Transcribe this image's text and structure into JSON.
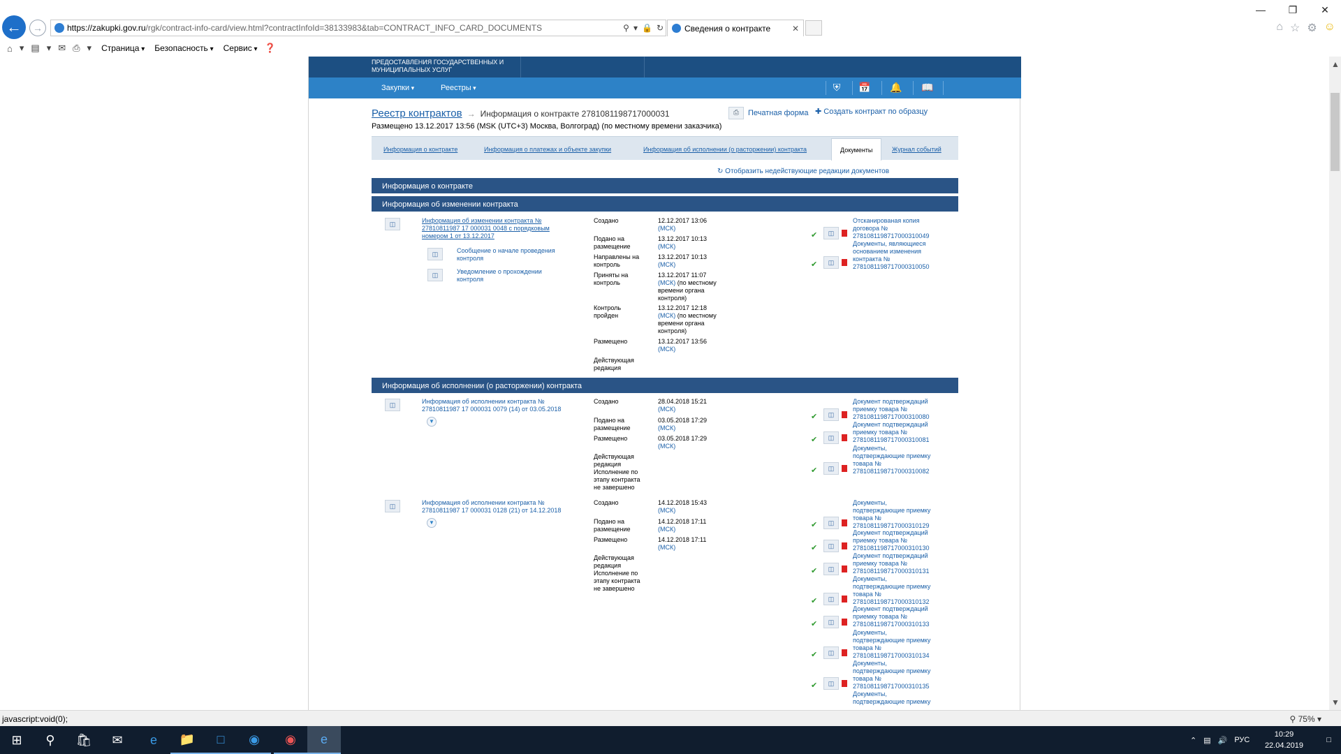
{
  "browser": {
    "url_host": "https://zakupki.gov.ru",
    "url_path": "/rgk/contract-info-card/view.html?contractInfoId=38133983&tab=CONTRACT_INFO_CARD_DOCUMENTS",
    "tab_title": "Сведения о контракте",
    "window_buttons": [
      "—",
      "❐",
      "✕"
    ],
    "menu": {
      "page": "Страница",
      "security": "Безопасность",
      "service": "Сервис"
    },
    "status_text": "javascript:void(0);",
    "zoom": "75%"
  },
  "site": {
    "brand_line1": "ПРЕДОСТАВЛЕНИЯ ГОСУДАРСТВЕННЫХ И",
    "brand_line2": "МУНИЦИПАЛЬНЫХ УСЛУГ",
    "nav": {
      "purchases": "Закупки",
      "registries": "Реестры"
    }
  },
  "header": {
    "breadcrumb_root": "Реестр контрактов",
    "breadcrumb_current": "Информация о контракте 2781081198717000031",
    "print": "Печатная форма",
    "create": "Создать контракт по образцу",
    "posted": "Размещено 13.12.2017 13:56 (MSK (UTC+3) Москва, Волгоград) (по местному времени заказчика)"
  },
  "tabs": [
    {
      "label": "Информация о контракте"
    },
    {
      "label": "Информация о платежах и объекте закупки"
    },
    {
      "label": "Информация об исполнении (о расторжении) контракта"
    },
    {
      "label": "Документы"
    },
    {
      "label": "Журнал событий"
    }
  ],
  "show_old": "Отобразить недействующие редакции документов",
  "sections": {
    "info": "Информация о контракте",
    "change": "Информация об изменении контракта",
    "exec": "Информация об исполнении (о расторжении) контракта"
  },
  "change_block": {
    "title_l1": "Информация об изменении контракта №",
    "title_l2": "27810811987 17 000031 0048 с порядковым",
    "title_l3": "номером 1 от 13.12.2017",
    "sub1_l1": "Сообщение о начале проведения",
    "sub1_l2": "контроля",
    "sub2_l1": "Уведомление о прохождении",
    "sub2_l2": "контроля",
    "labels": {
      "created": "Создано",
      "submitted_l1": "Подано на",
      "submitted_l2": "размещение",
      "sent_l1": "Направлены на",
      "sent_l2": "контроль",
      "accepted_l1": "Приняты на",
      "accepted_l2": "контроль",
      "passed_l1": "Контроль",
      "passed_l2": "пройден",
      "posted": "Размещено",
      "active_l1": "Действующая",
      "active_l2": "редакция"
    },
    "dates": {
      "created": "12.12.2017 13:06",
      "submitted": "13.12.2017 10:13",
      "sent": "13.12.2017 10:13",
      "accepted": "13.12.2017 11:07",
      "passed": "13.12.2017 12:18",
      "posted": "13.12.2017 13:56"
    },
    "msk": "(МСК)",
    "local_l1": "(по местному",
    "local_l2": "времени органа",
    "local_l3": "контроля)",
    "docs": [
      {
        "l1": "Отсканированая копия",
        "l2": "договора №",
        "l3": "2781081198717000310049"
      },
      {
        "l1": "Документы, являющиеся",
        "l2": "основанием изменения",
        "l3": "контракта №",
        "l4": "2781081198717000310050"
      }
    ]
  },
  "exec_block_1": {
    "title_l1": "Информация об исполнении контракта №",
    "title_l2": "27810811987 17 000031 0079 (14) от 03.05.2018",
    "created": "28.04.2018 15:21",
    "submitted": "03.05.2018 17:29",
    "posted": "03.05.2018 17:29",
    "labels": {
      "created": "Создано",
      "submitted_l1": "Подано на",
      "submitted_l2": "размещение",
      "posted": "Размещено",
      "active_l1": "Действующая",
      "active_l2": "редакция",
      "stage_l1": "Исполнение по",
      "stage_l2": "этапу контракта",
      "stage_l3": "не завершено"
    },
    "docs": [
      {
        "l1": "Документ подтверждаций",
        "l2": "приемку товара №",
        "l3": "2781081198717000310080"
      },
      {
        "l1": "Документ подтверждаций",
        "l2": "приемку товара №",
        "l3": "2781081198717000310081"
      },
      {
        "l1": "Документы,",
        "l2": "подтверждающие приемку",
        "l3": "товара №",
        "l4": "2781081198717000310082"
      }
    ]
  },
  "exec_block_2": {
    "title_l1": "Информация об исполнении контракта №",
    "title_l2": "27810811987 17 000031 0128 (21) от 14.12.2018",
    "created": "14.12.2018 15:43",
    "submitted": "14.12.2018 17:11",
    "posted": "14.12.2018 17:11",
    "docs": [
      {
        "l1": "Документы,",
        "l2": "подтверждающие приемку",
        "l3": "товара №",
        "l4": "2781081198717000310129"
      },
      {
        "l1": "Документ подтверждаций",
        "l2": "приемку товара №",
        "l3": "2781081198717000310130"
      },
      {
        "l1": "Документ подтверждаций",
        "l2": "приемку товара №",
        "l3": "2781081198717000310131"
      },
      {
        "l1": "Документы,",
        "l2": "подтверждающие приемку",
        "l3": "товара №",
        "l4": "2781081198717000310132"
      },
      {
        "l1": "Документ подтверждаций",
        "l2": "приемку товара №",
        "l3": "2781081198717000310133"
      },
      {
        "l1": "Документы,",
        "l2": "подтверждающие приемку",
        "l3": "товара №",
        "l4": "2781081198717000310134"
      },
      {
        "l1": "Документы,",
        "l2": "подтверждающие приемку",
        "l3": "товара №",
        "l4": "2781081198717000310135"
      },
      {
        "l1": "Документы,",
        "l2": "подтверждающие приемку"
      }
    ]
  },
  "taskbar": {
    "lang": "РУС",
    "time": "10:29",
    "date": "22.04.2019"
  }
}
